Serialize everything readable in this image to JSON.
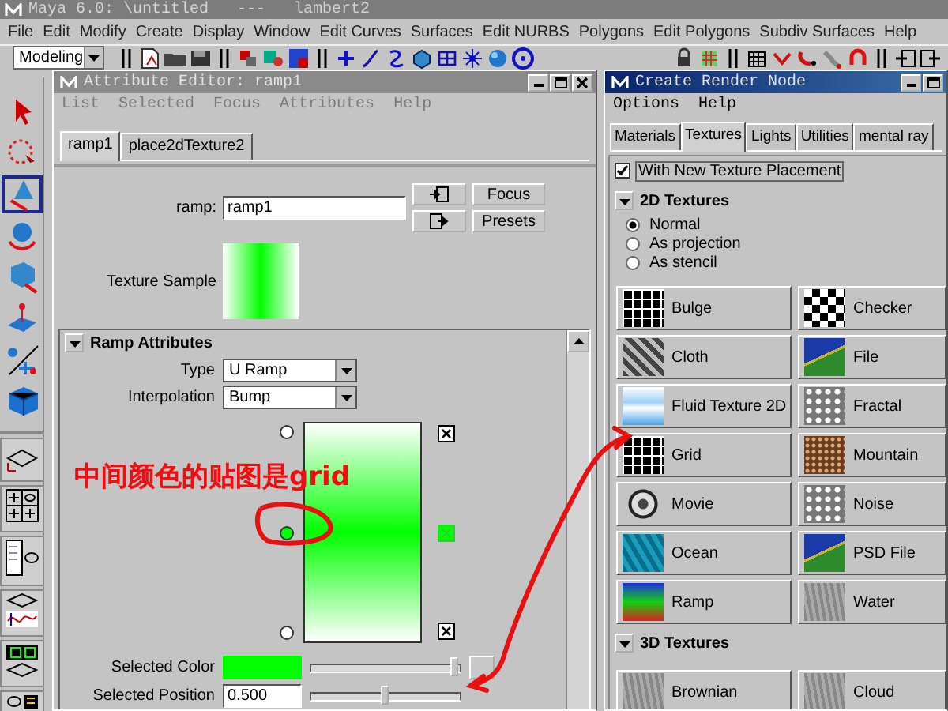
{
  "app": {
    "title": "Maya 6.0: \\untitled   ---   lambert2"
  },
  "menu_bar": [
    "File",
    "Edit",
    "Modify",
    "Create",
    "Display",
    "Window",
    "Edit Curves",
    "Surfaces",
    "Edit NURBS",
    "Polygons",
    "Edit Polygons",
    "Subdiv Surfaces",
    "Help"
  ],
  "status_line": {
    "menu_set": "Modeling"
  },
  "attribute_editor": {
    "title": "Attribute Editor: ramp1",
    "menus": [
      "List",
      "Selected",
      "Focus",
      "Attributes",
      "Help"
    ],
    "tabs": [
      {
        "label": "ramp1",
        "selected": true
      },
      {
        "label": "place2dTexture2",
        "selected": false
      }
    ],
    "node": {
      "label": "ramp:",
      "value": "ramp1"
    },
    "buttons": [
      "Focus",
      "Presets"
    ],
    "texture_sample": {
      "label": "Texture Sample"
    },
    "section": {
      "title": "Ramp Attributes",
      "expanded": true
    },
    "options": [
      {
        "label": "Type",
        "value": "U Ramp"
      },
      {
        "label": "Interpolation",
        "value": "Bump"
      }
    ],
    "ramp": {
      "handles": [
        {
          "color": "#ffffff",
          "selected": false
        },
        {
          "color": "#00ff00",
          "selected": true
        },
        {
          "color": "#ffffff",
          "selected": false
        }
      ]
    },
    "selected_color": {
      "label": "Selected Color",
      "color": "#00ff00",
      "level": 0.97
    },
    "selected_position": {
      "label": "Selected Position",
      "value": "0.500",
      "level": 0.5
    }
  },
  "render_node": {
    "title": "Create Render Node",
    "menus": [
      "Options",
      "Help"
    ],
    "tabs": [
      {
        "label": "Materials",
        "selected": false
      },
      {
        "label": "Textures",
        "selected": true
      },
      {
        "label": "Lights",
        "selected": false
      },
      {
        "label": "Utilities",
        "selected": false
      },
      {
        "label": "mental ray",
        "selected": false
      }
    ],
    "texture_placement": {
      "label": "With New Texture Placement",
      "checked": true
    },
    "sections": [
      {
        "title": "2D Textures",
        "expanded": true,
        "modes": [
          {
            "label": "Normal",
            "selected": true
          },
          {
            "label": "As projection",
            "selected": false
          },
          {
            "label": "As stencil",
            "selected": false
          }
        ],
        "nodes": [
          "Bulge",
          "Checker",
          "Cloth",
          "File",
          "Fluid Texture 2D",
          "Fractal",
          "Grid",
          "Mountain",
          "Movie",
          "Noise",
          "Ocean",
          "PSD File",
          "Ramp",
          "Water"
        ]
      },
      {
        "title": "3D Textures",
        "expanded": true,
        "nodes": [
          "Brownian",
          "Cloud"
        ]
      }
    ]
  },
  "annotation": {
    "text": "中间颜色的贴图是grid"
  }
}
